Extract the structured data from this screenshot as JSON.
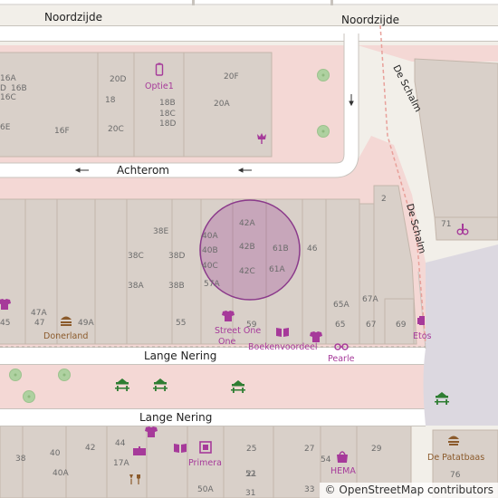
{
  "map": {
    "streets": {
      "noordzijde_left": "Noordzijde",
      "noordzijde_right": "Noordzijde",
      "achterom": "Achterom",
      "de_schalm_1": "De Schalm",
      "de_schalm_2": "De Schalm",
      "lange_nering_1": "Lange Nering",
      "lange_nering_2": "Lange Nering"
    },
    "pois": {
      "optie1": "Optie1",
      "donerland": "Donerland",
      "street_one": "Street One",
      "boekenvoordeel": "Boekenvoordeel",
      "pearle": "Pearle",
      "etos": "Etos",
      "primera": "Primera",
      "hema": "HEMA",
      "de_patatbaas": "De Patatbaas"
    },
    "house_numbers": {
      "n16a": "16A",
      "n16b": "16B",
      "n16c": "16C",
      "n16d": "D",
      "n16e": "6E",
      "n16f": "16F",
      "n20d": "20D",
      "n18": "18",
      "n20c": "20C",
      "n18b": "18B",
      "n18c": "18C",
      "n18d": "18D",
      "n20f": "20F",
      "n20a": "20A",
      "n2": "2",
      "n71": "71",
      "n38e": "38E",
      "n38c": "38C",
      "n38d": "38D",
      "n38a": "38A",
      "n38b": "38B",
      "n40a": "40A",
      "n40b": "40B",
      "n40c": "40C",
      "n42a": "42A",
      "n42b": "42B",
      "n42c": "42C",
      "n61b": "61B",
      "n61a": "61A",
      "n46": "46",
      "n57a": "57A",
      "n65a": "65A",
      "n67a": "67A",
      "n45": "45",
      "n47a": "47A",
      "n47": "47",
      "n49a": "49A",
      "n55": "55",
      "n59": "59",
      "n65": "65",
      "n67": "67",
      "n69": "69",
      "s38": "38",
      "s40": "40",
      "s42": "42",
      "s44": "44",
      "s40a": "40A",
      "s17a": "17A",
      "s50a": "50A",
      "s25": "25",
      "s27": "27",
      "s29": "29",
      "s21": "21",
      "s52": "52",
      "s54": "54",
      "s76": "76",
      "s31": "31",
      "s33": "33"
    },
    "colors": {
      "background": "#f2efe9",
      "building": "#d9d0c9",
      "building_stroke": "#c4b6ab",
      "pedestrian": "#f4d8d5",
      "road": "#ffffff",
      "road_casing": "#c8c3bd",
      "poi_purple": "#a63a9a",
      "poi_brown": "#8b5a2b",
      "poi_green": "#2e7d32",
      "tree": "#aed1a0",
      "marker_fill": "rgba(128, 0, 128, 0.2)",
      "marker_stroke": "#8b3a8b",
      "footway": "#e8a09a"
    },
    "icons": [
      "phone-icon",
      "flower-icon",
      "teddy-icon",
      "shirt-icon",
      "kebab-icon",
      "book-icon",
      "glasses-icon",
      "pharmacy-icon",
      "picnic-table-icon",
      "gift-icon",
      "frame-icon",
      "department-store-icon",
      "fries-icon",
      "bar-icon",
      "one-way-arrow-icon",
      "tree-icon"
    ]
  },
  "attribution": {
    "symbol": "©",
    "text": "OpenStreetMap contributors"
  }
}
